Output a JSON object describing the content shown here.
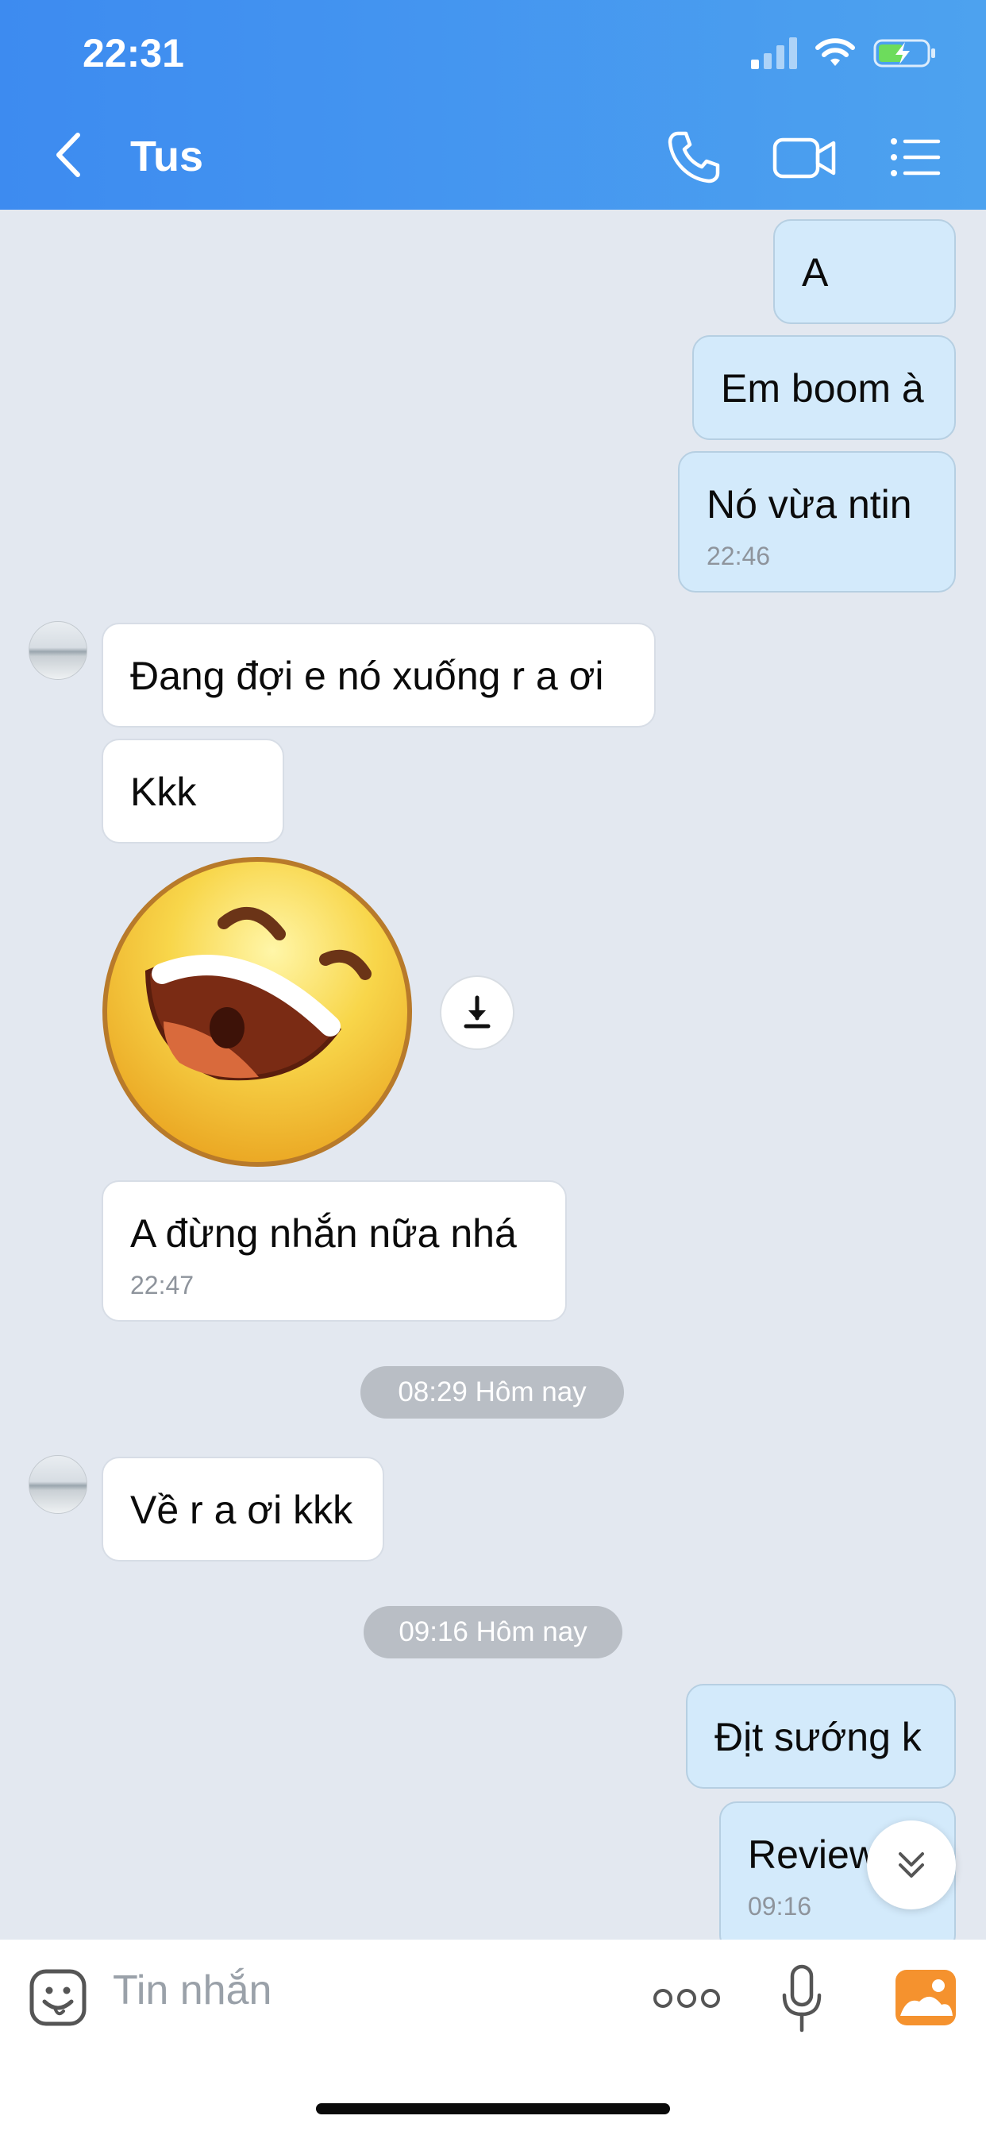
{
  "status_bar": {
    "time": "22:31"
  },
  "header": {
    "title": "Tus",
    "icons": [
      "back-chevron-icon",
      "phone-icon",
      "video-call-icon",
      "menu-list-icon"
    ]
  },
  "messages": {
    "m1": "A",
    "m2": "Em boom à",
    "m3": "Nó vừa ntin",
    "m3_time": "22:46",
    "m4": "Đang đợi e nó xuống r a ơi",
    "m5": "Kkk",
    "sticker": "laughing-face-sticker",
    "m6": "A đừng nhắn nữa nhá",
    "m6_time": "22:47",
    "divider1": "08:29 Hôm nay",
    "m7": "Về r a ơi kkk",
    "divider2": "09:16 Hôm nay",
    "m8": "Địt sướng k",
    "m9": "Review",
    "m9_time": "09:16"
  },
  "composer": {
    "placeholder": "Tin nhắn",
    "icons": [
      "sticker-icon",
      "more-options-icon",
      "microphone-icon",
      "photo-gallery-icon"
    ]
  },
  "colors": {
    "header_gradient_start": "#3d8bf0",
    "header_gradient_end": "#4da2ef",
    "chat_background": "#e3e8f0",
    "outgoing_bubble": "#d3eafb",
    "incoming_bubble": "#ffffff",
    "accent_orange": "#f5922e"
  }
}
